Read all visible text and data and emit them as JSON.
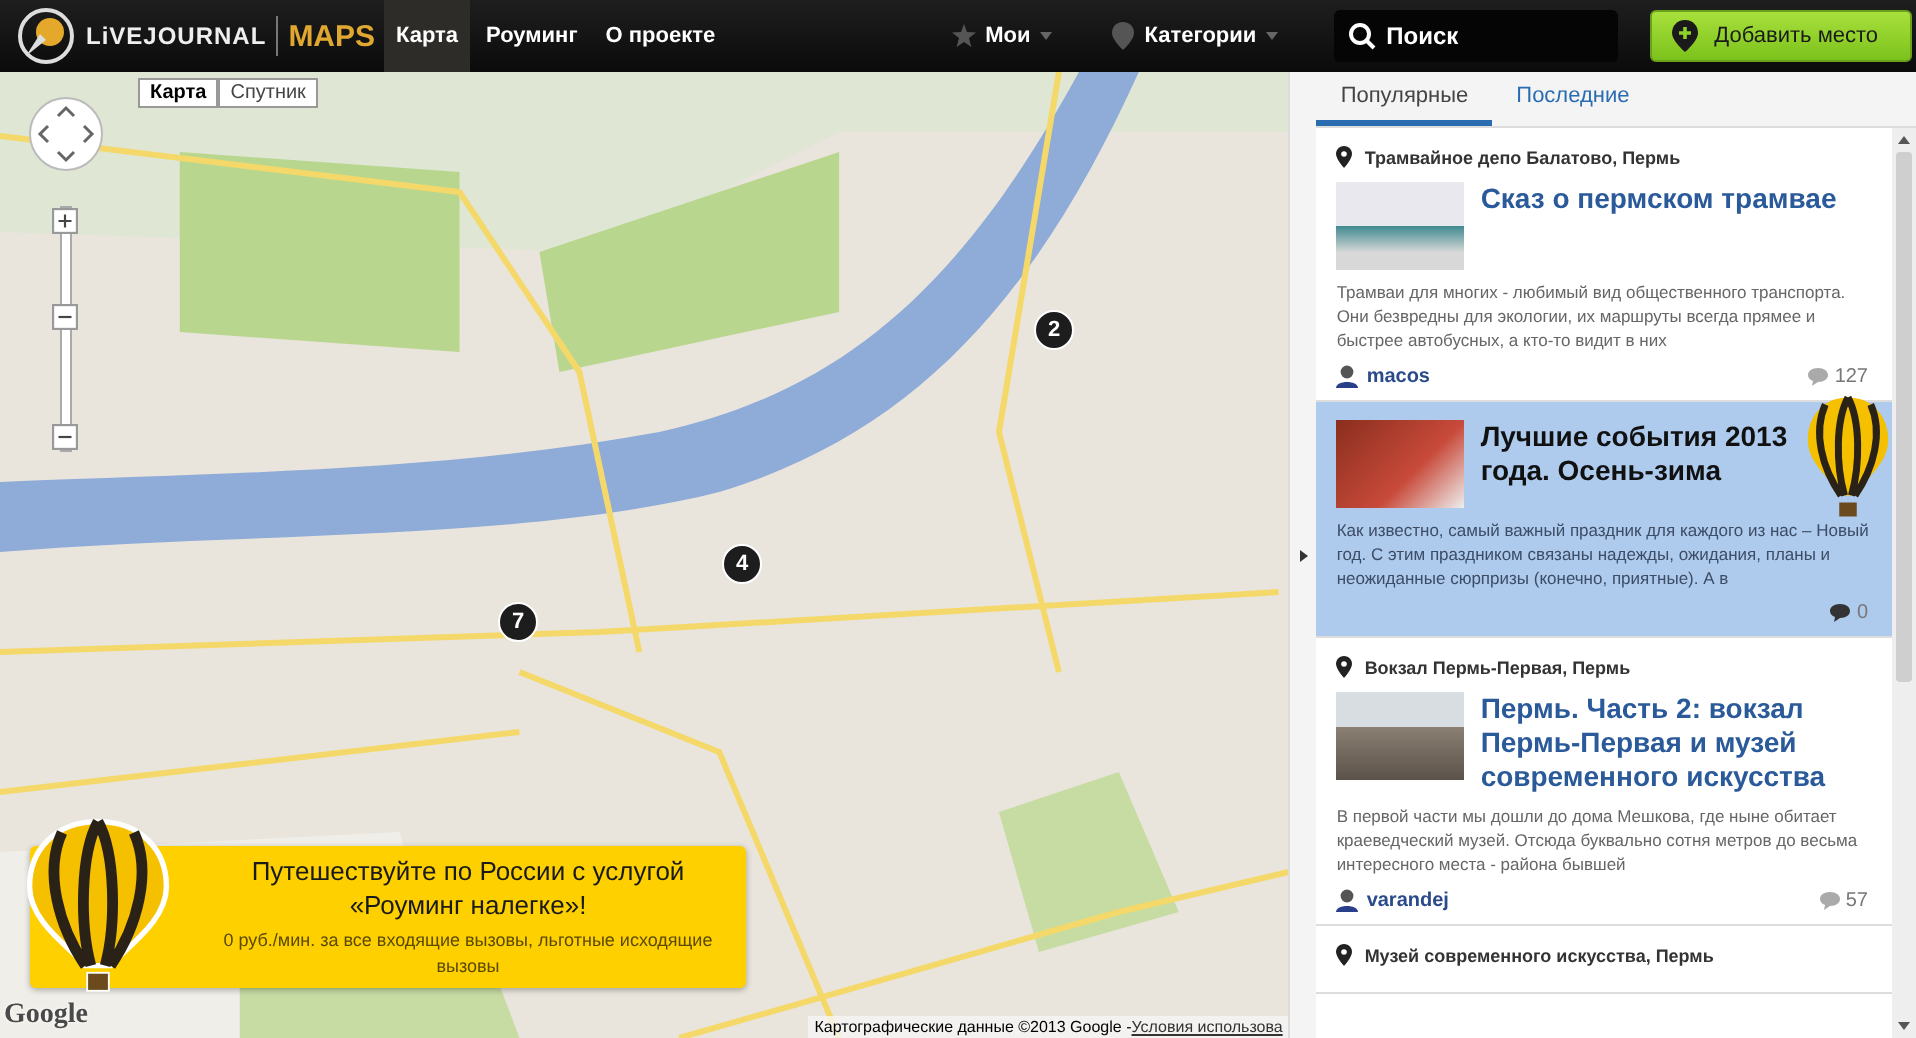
{
  "header": {
    "logo": {
      "brand": "LiVEJOURNAL",
      "product": "MAPS"
    },
    "nav": [
      {
        "label": "Карта",
        "selected": true
      },
      {
        "label": "Роуминг",
        "selected": false
      },
      {
        "label": "О проекте",
        "selected": false
      }
    ],
    "menus": [
      {
        "label": "Мои",
        "kind": "star"
      },
      {
        "label": "Категории",
        "kind": "pin"
      }
    ],
    "search": {
      "placeholder": "Поиск"
    },
    "add_button": "Добавить место"
  },
  "map": {
    "type_buttons": [
      {
        "label": "Карта",
        "selected": true
      },
      {
        "label": "Спутник",
        "selected": false
      }
    ],
    "zoom": {
      "level": 0.56
    },
    "markers": [
      {
        "label": "2"
      },
      {
        "label": "4"
      },
      {
        "label": "7"
      }
    ],
    "ad": {
      "title": "Путешествуйте по России с услугой «Роуминг налегке»!",
      "text": "0 руб./мин. за все входящие вызовы, льготные исходящие вызовы"
    },
    "google_logo": "Google",
    "attribution": "Картографические данные ©2013 Google - ",
    "terms_link": "Условия использова"
  },
  "sidebar": {
    "tabs": [
      {
        "label": "Популярные",
        "selected": true
      },
      {
        "label": "Последние",
        "selected": false
      }
    ],
    "posts": [
      {
        "location": "Трамвайное депо Балатово, Пермь",
        "title": "Сказ о пермском трамвае",
        "excerpt": "Трамваи для многих - любимый вид общественного транспорта. Они безвредны для экологии, их маршруты всегда прямее и быстрее автобусных, а кто-то видит в них",
        "author": "macos",
        "comments": "127",
        "selected": false
      },
      {
        "title": "Лучшие события 2013 года. Осень-зима",
        "excerpt": "Как известно, самый важный праздник для каждого из нас – Новый год. С этим праздником связаны надежды, ожидания, планы и неожиданные сюрпризы (конечно, приятные). А в",
        "comments": "0",
        "selected": true
      },
      {
        "location": "Вокзал Пермь-Первая, Пермь",
        "title": "Пермь. Часть 2: вокзал Пермь-Первая и музей современного искусства",
        "excerpt": "В первой части мы дошли до дома Мешкова, где ныне обитает краеведческий музей. Отсюда буквально сотня метров до весьма интересного места - района бывшей",
        "author": "varandej",
        "comments": "57",
        "selected": false
      },
      {
        "location": "Музей современного искусства, Пермь"
      }
    ]
  }
}
